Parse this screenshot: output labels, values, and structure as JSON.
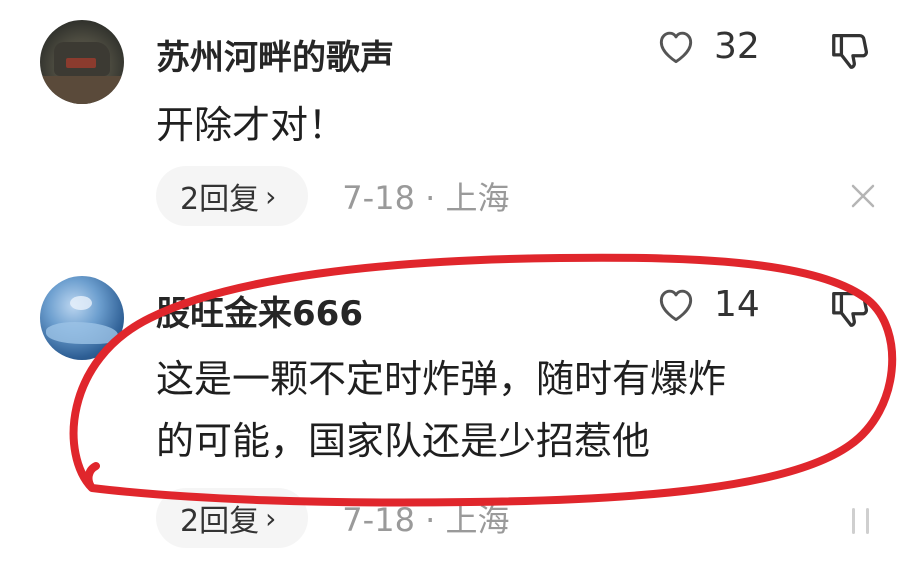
{
  "comments": [
    {
      "username": "苏州河畔的歌声",
      "likes": "32",
      "text_lines": [
        "开除才对！"
      ],
      "reply_label": "2回复",
      "reply_chevron": "›",
      "meta": "7-18 · 上海",
      "avatar": "dark-vehicle-photo"
    },
    {
      "username": "股旺金来666",
      "likes": "14",
      "text_lines": [
        "这是一颗不定时炸弹，随时有爆炸",
        "的可能，国家队还是少招惹他"
      ],
      "reply_label": "2回复",
      "reply_chevron": "›",
      "meta": "7-18 · 上海",
      "avatar": "blue-sea-photo"
    }
  ],
  "icons": {
    "like": "heart-outline-icon",
    "dislike": "thumbs-down-icon",
    "close": "close-icon"
  },
  "annotation_color": "#e0262c"
}
